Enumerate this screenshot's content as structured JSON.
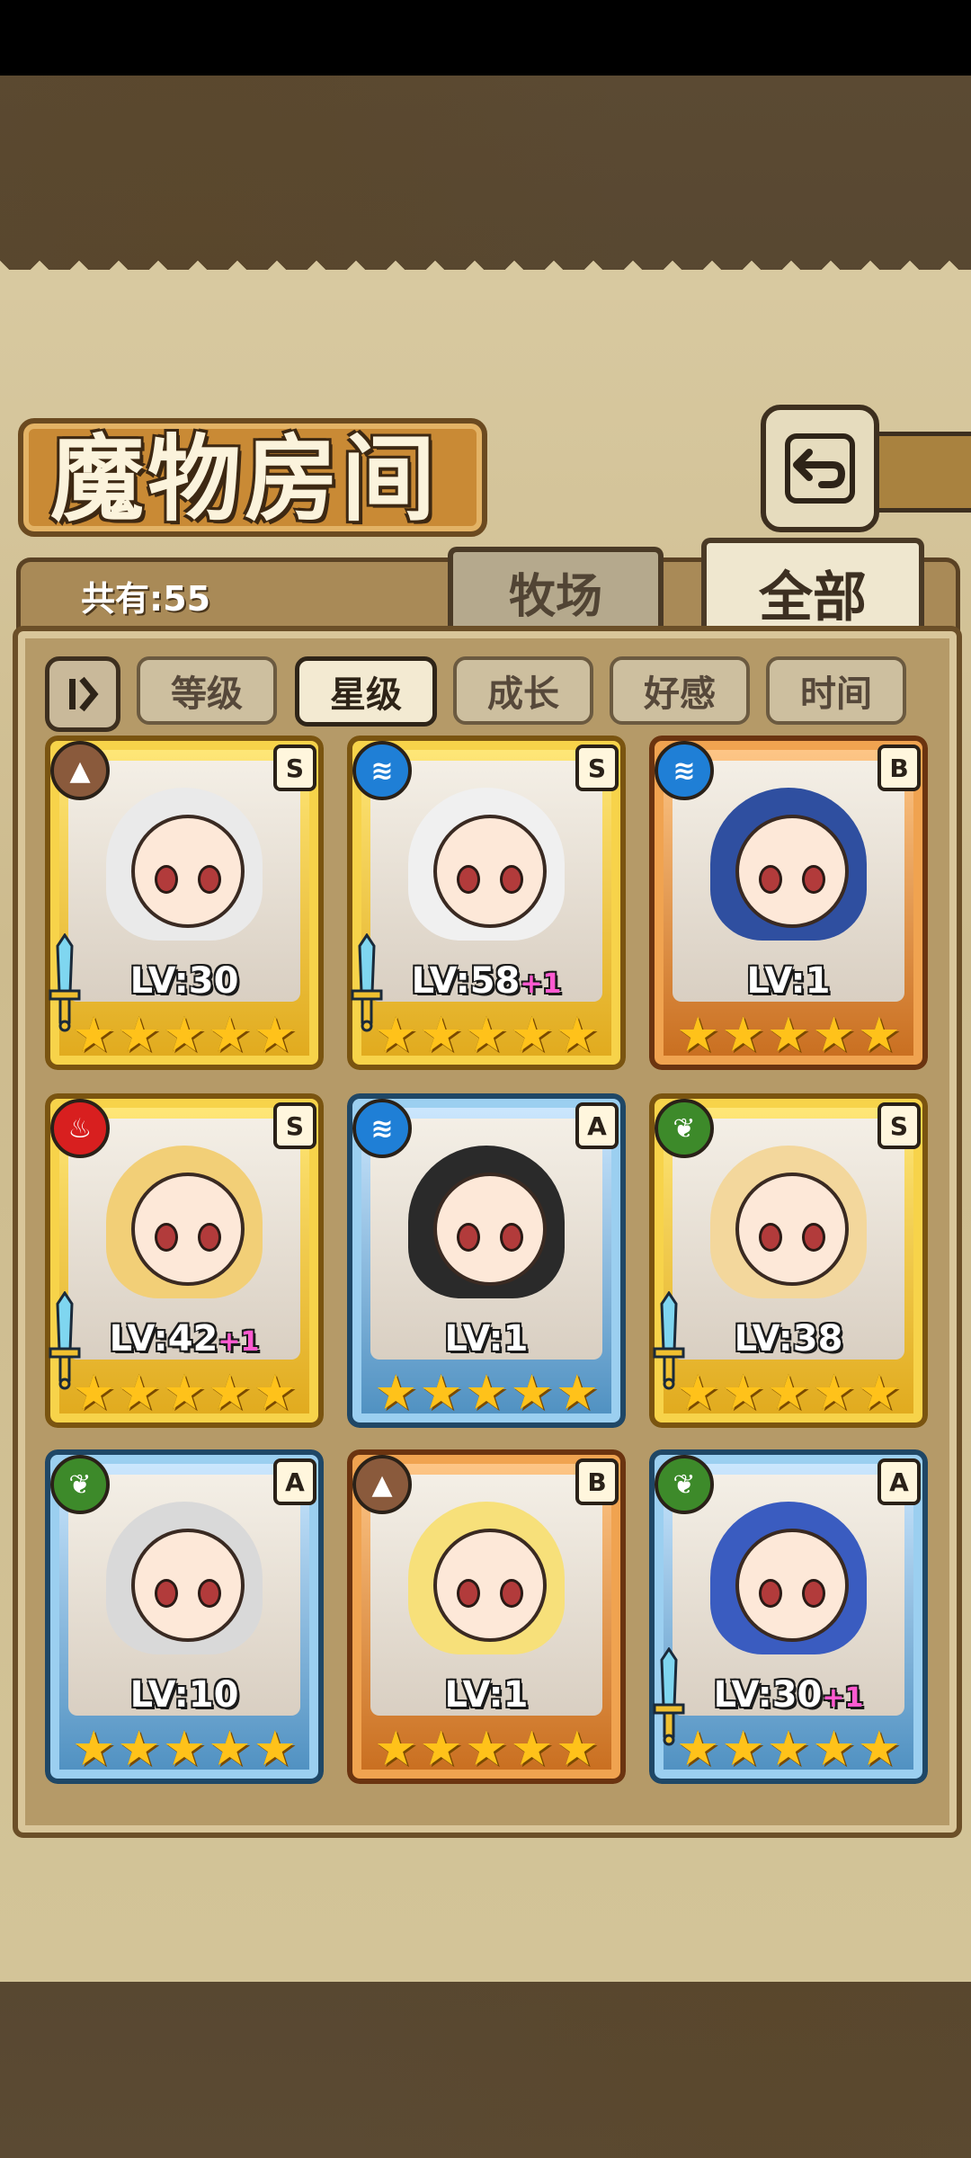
{
  "header": {
    "title": "魔物房间",
    "back_icon": "return-arrow-icon"
  },
  "summary": {
    "count_label": "共有:55"
  },
  "tabs": [
    {
      "label": "牧场"
    },
    {
      "label": "全部"
    }
  ],
  "filters": {
    "toggle_icon": "sort-toggle-icon",
    "items": [
      {
        "label": "等级"
      },
      {
        "label": "星级"
      },
      {
        "label": "成长"
      },
      {
        "label": "好感"
      },
      {
        "label": "时间"
      }
    ]
  },
  "cards": [
    {
      "element": "earth",
      "rank": "S",
      "lv": "LV:30",
      "plus": "",
      "stars": 5,
      "has_weapon": true
    },
    {
      "element": "water",
      "rank": "S",
      "lv": "LV:58",
      "plus": "+1",
      "stars": 5,
      "has_weapon": true
    },
    {
      "element": "water",
      "rank": "B",
      "lv": "LV:1",
      "plus": "",
      "stars": 5,
      "has_weapon": false
    },
    {
      "element": "fire",
      "rank": "S",
      "lv": "LV:42",
      "plus": "+1",
      "stars": 5,
      "has_weapon": true
    },
    {
      "element": "water",
      "rank": "A",
      "lv": "LV:1",
      "plus": "",
      "stars": 5,
      "has_weapon": false
    },
    {
      "element": "wood",
      "rank": "S",
      "lv": "LV:38",
      "plus": "",
      "stars": 5,
      "has_weapon": true
    },
    {
      "element": "wood",
      "rank": "A",
      "lv": "LV:10",
      "plus": "",
      "stars": 5,
      "has_weapon": false
    },
    {
      "element": "earth",
      "rank": "B",
      "lv": "LV:1",
      "plus": "",
      "stars": 5,
      "has_weapon": false
    },
    {
      "element": "wood",
      "rank": "A",
      "lv": "LV:30",
      "plus": "+1",
      "stars": 5,
      "has_weapon": true
    }
  ],
  "colors": {
    "earth": "#8a5a3c",
    "water": "#1f7fd6",
    "fire": "#d81f1f",
    "wood": "#3d8a2a"
  }
}
